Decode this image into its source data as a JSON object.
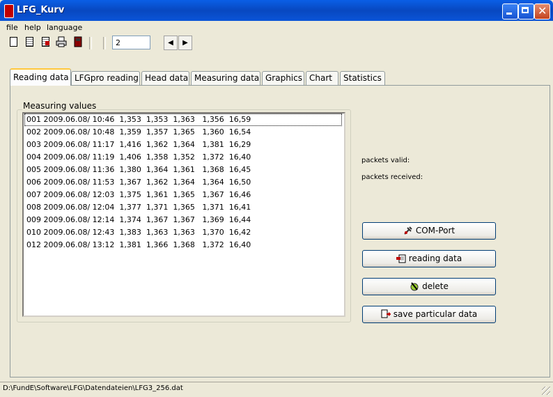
{
  "window": {
    "title": "LFG_Kurv"
  },
  "menu": [
    "file",
    "help",
    "language"
  ],
  "toolbar": {
    "page_value": "2",
    "prev_icon": "arrow-left-icon",
    "next_icon": "arrow-right-icon"
  },
  "tabs": [
    "Reading data",
    "LFGpro reading",
    "Head data",
    "Measuring data",
    "Graphics",
    "Chart",
    "Statistics"
  ],
  "active_tab": "Reading data",
  "measuring": {
    "label": "Measuring values",
    "rows": [
      "001 2009.06.08/ 10:46  1,353  1,353  1,363   1,356  16,59",
      "002 2009.06.08/ 10:48  1,359  1,357  1,365   1,360  16,54",
      "003 2009.06.08/ 11:17  1,416  1,362  1,364   1,381  16,29",
      "004 2009.06.08/ 11:19  1,406  1,358  1,352   1,372  16,40",
      "005 2009.06.08/ 11:36  1,380  1,364  1,361   1,368  16,45",
      "006 2009.06.08/ 11:53  1,367  1,362  1,364   1,364  16,50",
      "007 2009.06.08/ 12:03  1,375  1,361  1,365   1,367  16,46",
      "008 2009.06.08/ 12:04  1,377  1,371  1,365   1,371  16,41",
      "009 2009.06.08/ 12:14  1,374  1,367  1,367   1,369  16,44",
      "010 2009.06.08/ 12:43  1,383  1,363  1,363   1,370  16,42",
      "012 2009.06.08/ 13:12  1,381  1,366  1,368   1,372  16,40"
    ]
  },
  "info": {
    "packets_valid": "packets valid:",
    "packets_received": "packets received:"
  },
  "buttons": {
    "com_port": "COM-Port",
    "reading_data": "reading data",
    "delete": "delete",
    "save": "save particular data"
  },
  "status": {
    "path": "D:\\FundE\\Software\\LFG\\Datendateien\\LFG3_256.dat"
  },
  "colors": {
    "title_bar": "#0A5FE6",
    "window_bg": "#ECE9D8",
    "tab_highlight": "#FFC83C"
  }
}
